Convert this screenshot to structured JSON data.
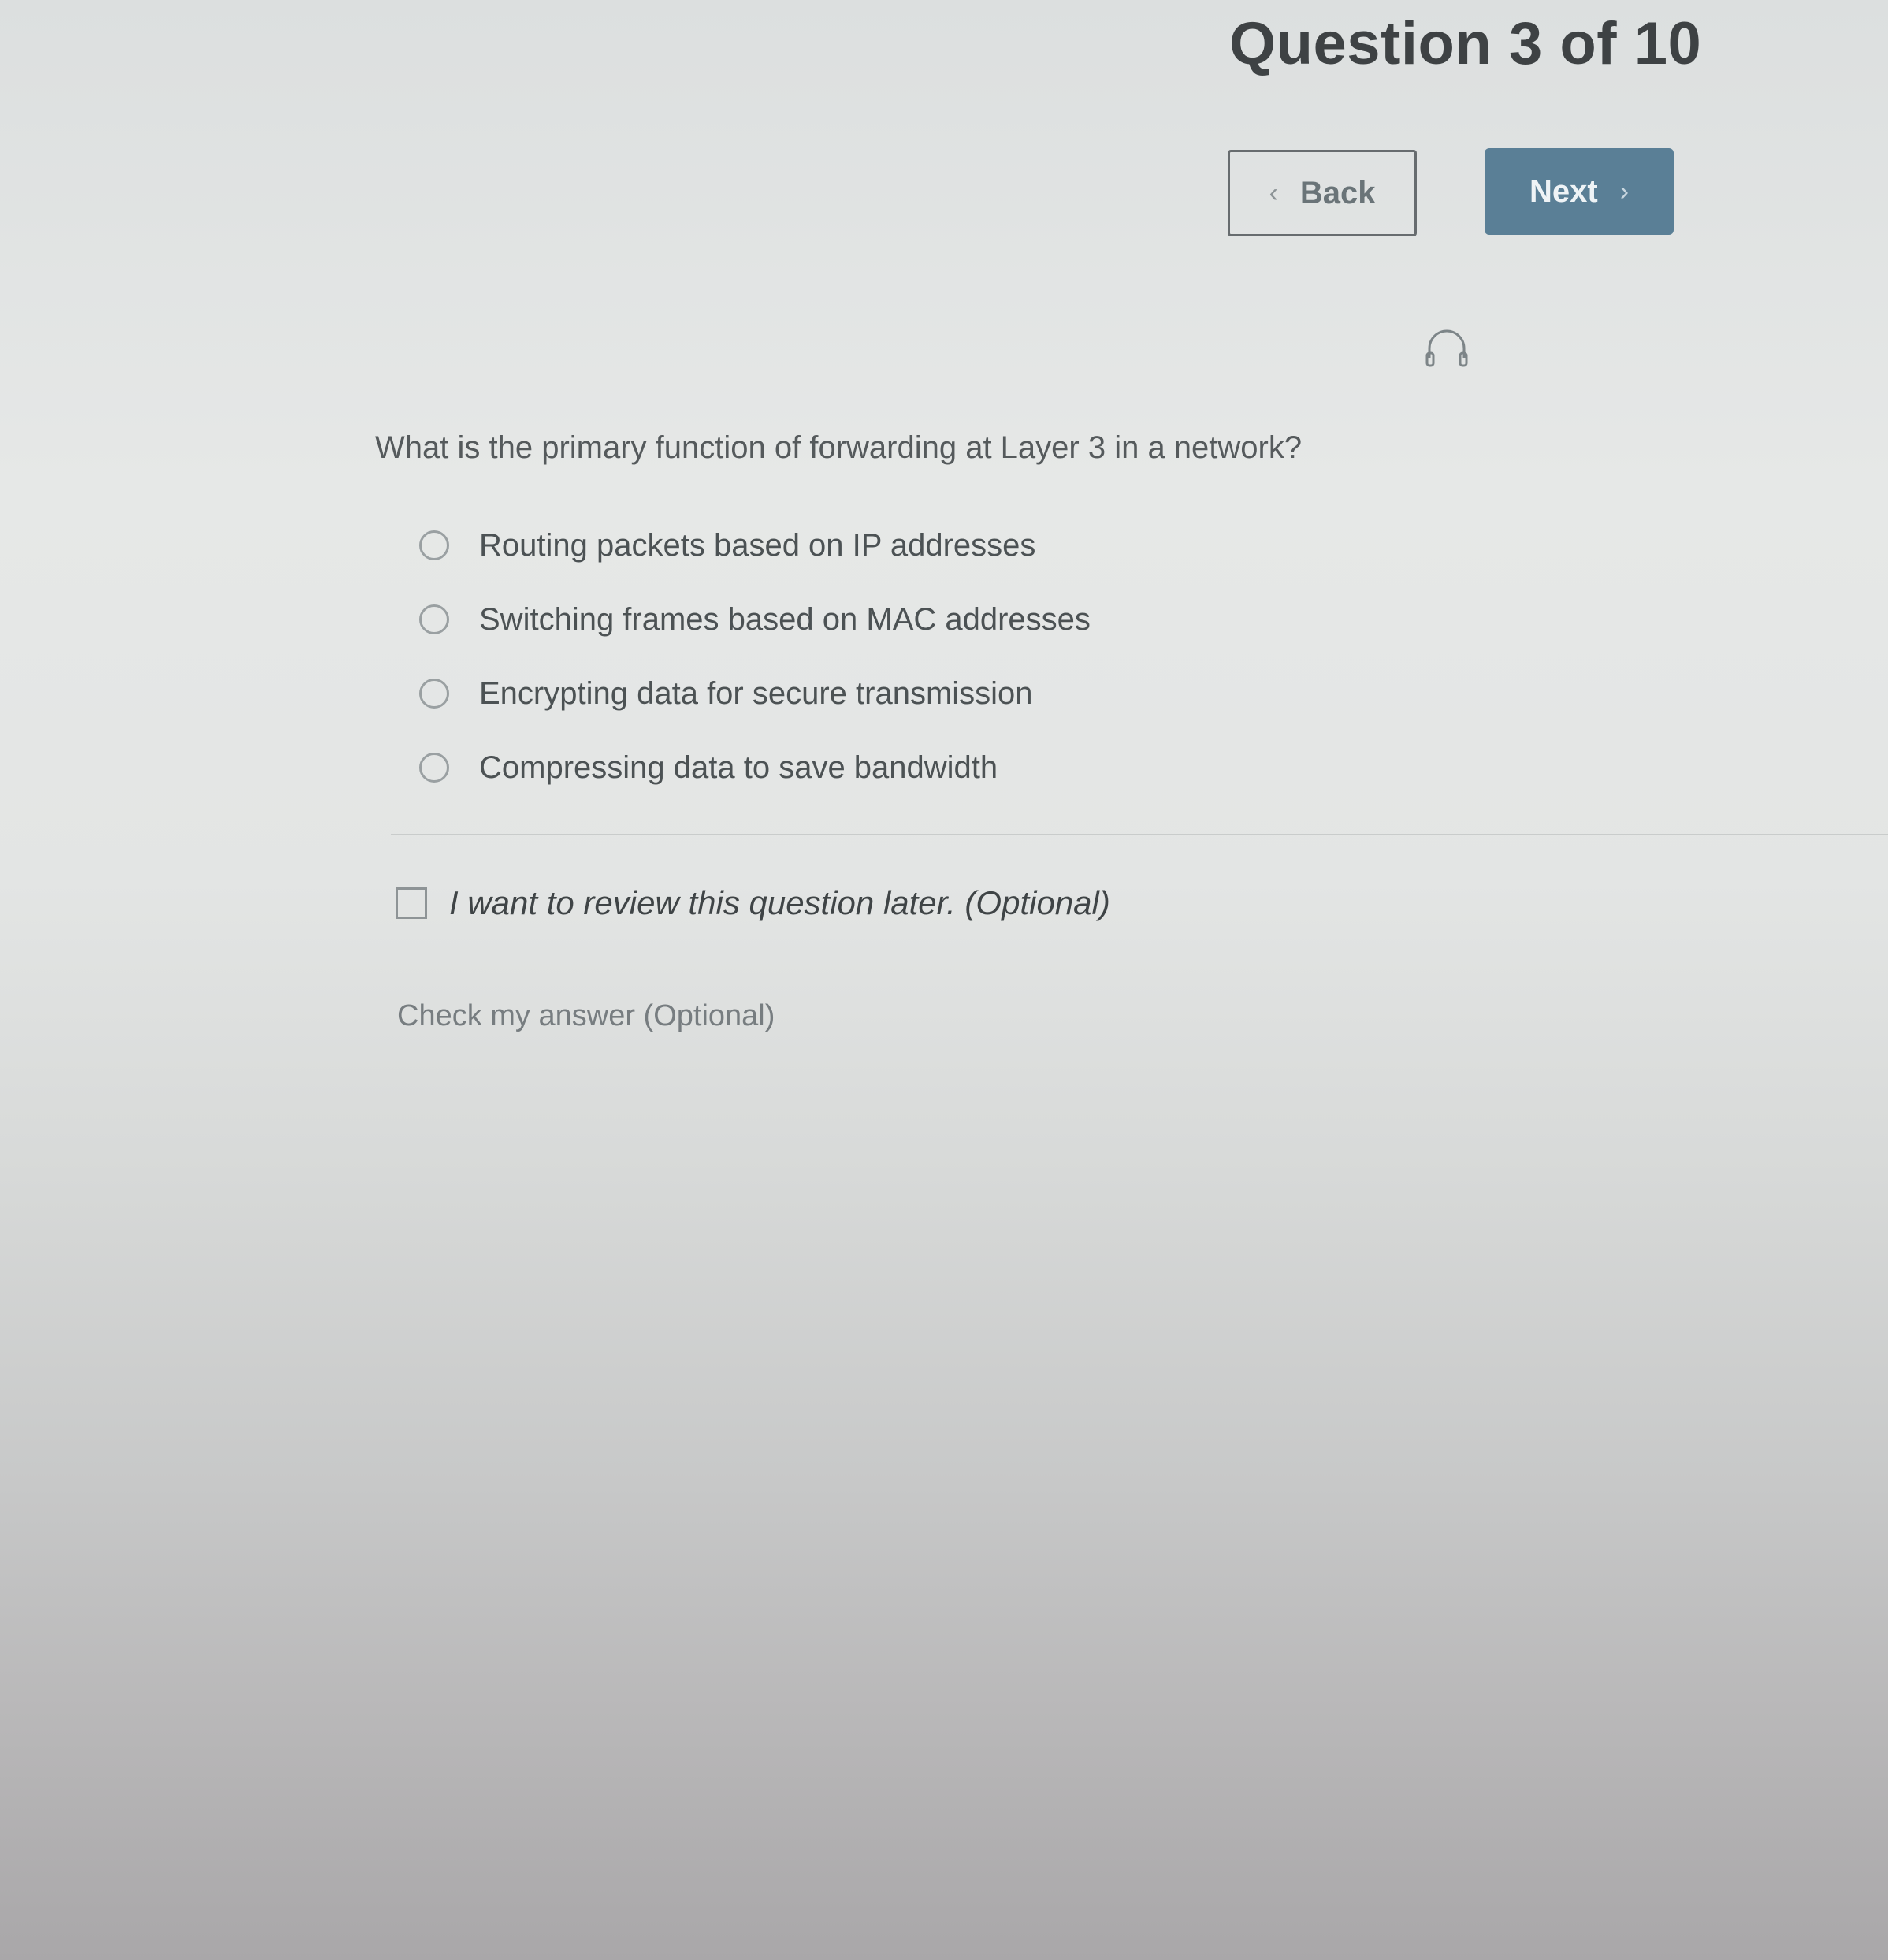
{
  "header": {
    "title": "Question 3 of 10"
  },
  "navigation": {
    "back_label": "Back",
    "next_label": "Next",
    "back_icon": "chevron-left-icon",
    "next_icon": "chevron-right-icon"
  },
  "audio": {
    "icon": "headphones-icon"
  },
  "question": {
    "text": "What is the primary function of forwarding at Layer 3 in a network?",
    "options": [
      {
        "label": "Routing packets based on IP addresses",
        "selected": false
      },
      {
        "label": "Switching frames based on MAC addresses",
        "selected": false
      },
      {
        "label": "Encrypting data for secure transmission",
        "selected": false
      },
      {
        "label": "Compressing data to save bandwidth",
        "selected": false
      }
    ]
  },
  "review": {
    "label": "I want to review this question later. (Optional)",
    "checked": false
  },
  "check_answer": {
    "label": "Check my answer (Optional)"
  },
  "colors": {
    "next_button": "#5a7f96",
    "title_text": "#3e4244"
  }
}
